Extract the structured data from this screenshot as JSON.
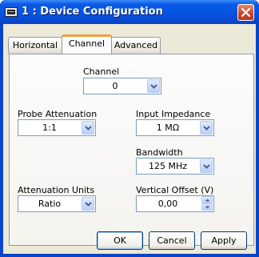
{
  "window": {
    "title": "1 : Device Configuration",
    "app_icon": "oscilloscope-icon"
  },
  "tabs": [
    {
      "label": "Horizontal",
      "active": false
    },
    {
      "label": "Channel",
      "active": true
    },
    {
      "label": "Advanced",
      "active": false
    }
  ],
  "channel": {
    "channel_label": "Channel",
    "channel_value": "0",
    "probe_attenuation_label": "Probe Attenuation",
    "probe_attenuation_value": "1:1",
    "input_impedance_label": "Input Impedance",
    "input_impedance_value": "1 MΩ",
    "bandwidth_label": "Bandwidth",
    "bandwidth_value": "125 MHz",
    "attenuation_units_label": "Attenuation Units",
    "attenuation_units_value": "Ratio",
    "vertical_offset_label": "Vertical Offset (V)",
    "vertical_offset_value": "0,00"
  },
  "buttons": {
    "ok": "OK",
    "cancel": "Cancel",
    "apply": "Apply"
  },
  "colors": {
    "title_bar": "#0554e3",
    "dialog_bg": "#ece9d8",
    "active_tab_accent": "#e8a33a",
    "close_button": "#c9452a"
  }
}
